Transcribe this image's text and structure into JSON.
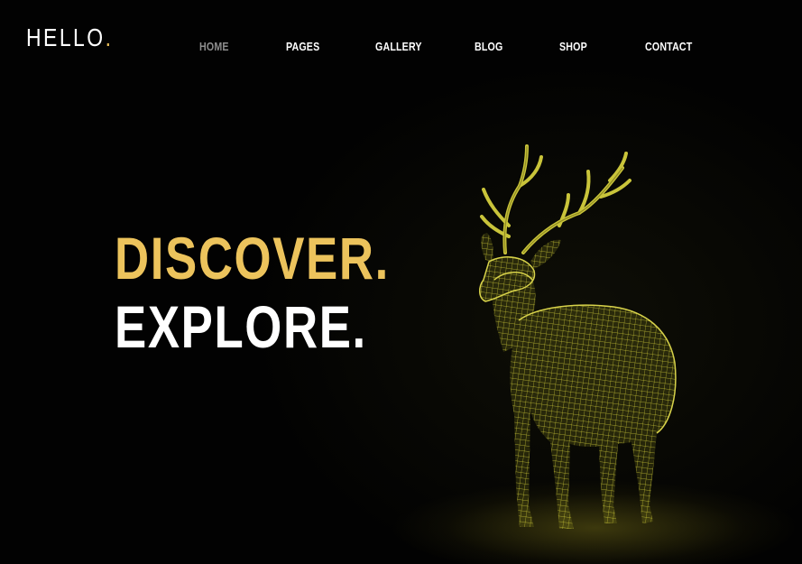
{
  "logo": {
    "text": "HELLO",
    "dot": "."
  },
  "nav": {
    "items": [
      {
        "label": "HOME",
        "active": true
      },
      {
        "label": "PAGES",
        "active": false
      },
      {
        "label": "GALLERY",
        "active": false
      },
      {
        "label": "BLOG",
        "active": false
      },
      {
        "label": "SHOP",
        "active": false
      },
      {
        "label": "CONTACT",
        "active": false
      }
    ]
  },
  "hero": {
    "line1": "DISCOVER.",
    "line2": "EXPLORE."
  },
  "image": {
    "subject": "wireframe-deer"
  },
  "colors": {
    "accent": "#ecc35c",
    "background": "#020202",
    "text": "#ffffff",
    "nav_active": "#8e8e8e",
    "wireframe": "#c9c43a"
  }
}
